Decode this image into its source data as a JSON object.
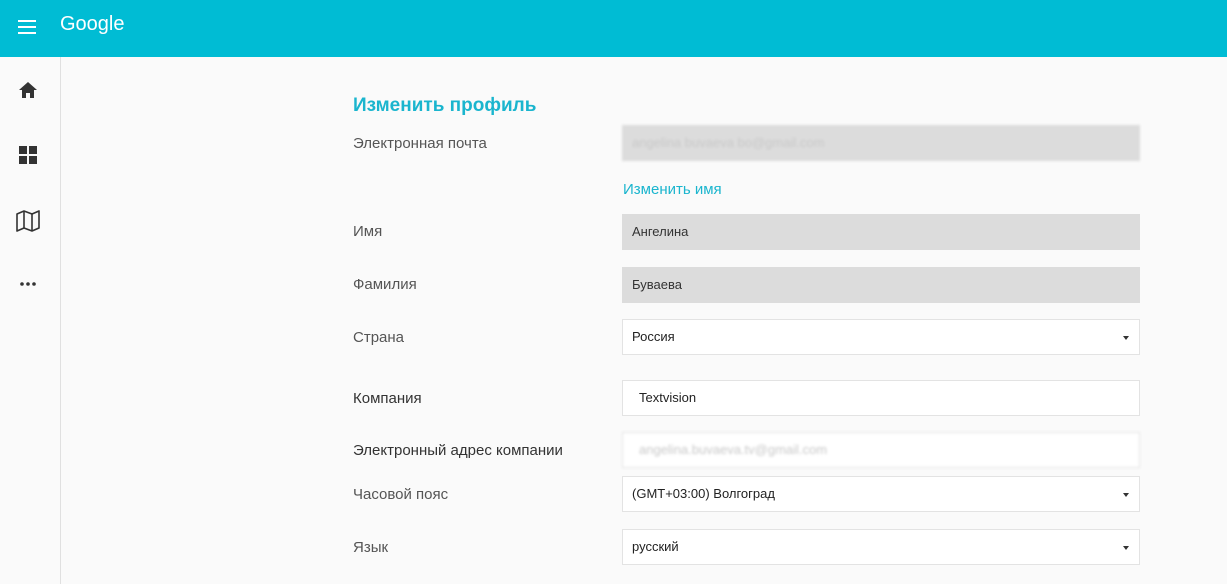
{
  "header": {
    "title": "Google"
  },
  "sidebar": {
    "items": [
      {
        "icon": "home-icon"
      },
      {
        "icon": "dashboard-icon"
      },
      {
        "icon": "map-icon"
      },
      {
        "icon": "more-icon"
      }
    ]
  },
  "profile": {
    "title": "Изменить профиль",
    "email_label": "Электронная почта",
    "email_value": "angelina buvaeva bo@gmail.com",
    "change_name_link": "Изменить имя",
    "first_name_label": "Имя",
    "first_name_value": "Ангелина",
    "last_name_label": "Фамилия",
    "last_name_value": "Буваева",
    "country_label": "Страна",
    "country_value": "Россия",
    "company_label": "Компания",
    "company_value": "Textvision",
    "company_email_label": "Электронный адрес компании",
    "company_email_value": "angelina.buvaeva.tv@gmail.com",
    "timezone_label": "Часовой пояс",
    "timezone_value": "(GMT+03:00) Волгоград",
    "language_label": "Язык",
    "language_value": "русский"
  },
  "colors": {
    "accent": "#00bcd4",
    "link": "#1ab5ce"
  }
}
